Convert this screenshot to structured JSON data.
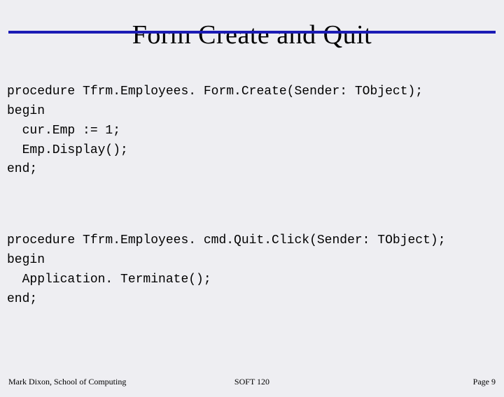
{
  "slide": {
    "title": "Form Create and Quit"
  },
  "code1": {
    "l0": "procedure Tfrm.Employees. Form.Create(Sender: TObject);",
    "l1": "begin",
    "l2": "  cur.Emp := 1;",
    "l3": "  Emp.Display();",
    "l4": "end;"
  },
  "code2": {
    "l0": "procedure Tfrm.Employees. cmd.Quit.Click(Sender: TObject);",
    "l1": "begin",
    "l2": "  Application. Terminate();",
    "l3": "end;"
  },
  "footer": {
    "left": "Mark Dixon, School of Computing",
    "center": "SOFT 120",
    "right": "Page 9"
  }
}
